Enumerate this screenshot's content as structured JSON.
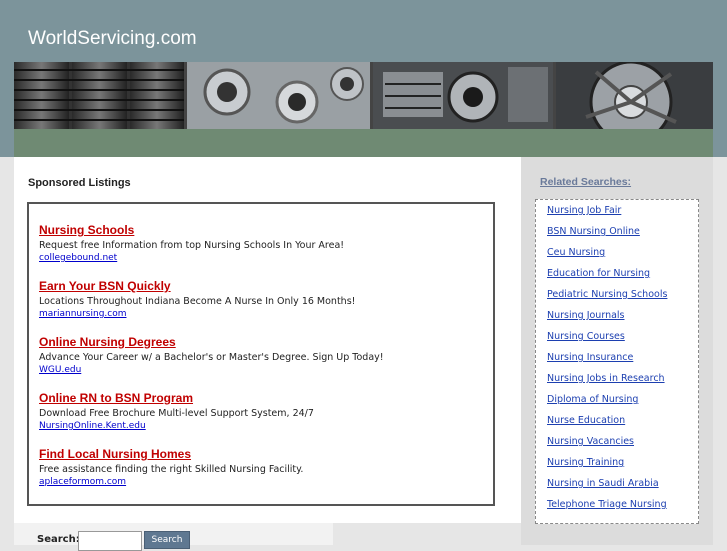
{
  "site": {
    "title": "WorldServicing.com"
  },
  "sponsored": {
    "heading": "Sponsored Listings",
    "listings": [
      {
        "title": "Nursing Schools",
        "description": "Request free Information from top Nursing Schools In Your Area!",
        "url": "collegebound.net"
      },
      {
        "title": "Earn Your BSN Quickly",
        "description": "Locations Throughout Indiana Become A Nurse In Only 16 Months!",
        "url": "mariannursing.com"
      },
      {
        "title": "Online Nursing Degrees",
        "description": "Advance Your Career w/ a Bachelor's or Master's Degree. Sign Up Today!",
        "url": "WGU.edu"
      },
      {
        "title": "Online RN to BSN Program",
        "description": "Download Free Brochure Multi-level Support System, 24/7",
        "url": "NursingOnline.Kent.edu"
      },
      {
        "title": "Find Local Nursing Homes",
        "description": "Free assistance finding the right Skilled Nursing Facility.",
        "url": "aplaceformom.com"
      }
    ]
  },
  "related": {
    "heading": "Related Searches:",
    "items": [
      "Nursing Job Fair",
      "BSN Nursing Online",
      "Ceu Nursing",
      "Education for Nursing",
      "Pediatric Nursing Schools",
      "Nursing Journals",
      "Nursing Courses",
      "Nursing Insurance",
      "Nursing Jobs in Research",
      "Diploma of Nursing",
      "Nurse Education",
      "Nursing Vacancies",
      "Nursing Training",
      "Nursing in Saudi Arabia",
      "Telephone Triage Nursing"
    ]
  },
  "search": {
    "label": "Search:",
    "button": "Search",
    "value": ""
  },
  "colors": {
    "header": "#7c949b",
    "band": "#6f8a73",
    "link_title": "#c00000",
    "link": "#1c3fb0"
  }
}
